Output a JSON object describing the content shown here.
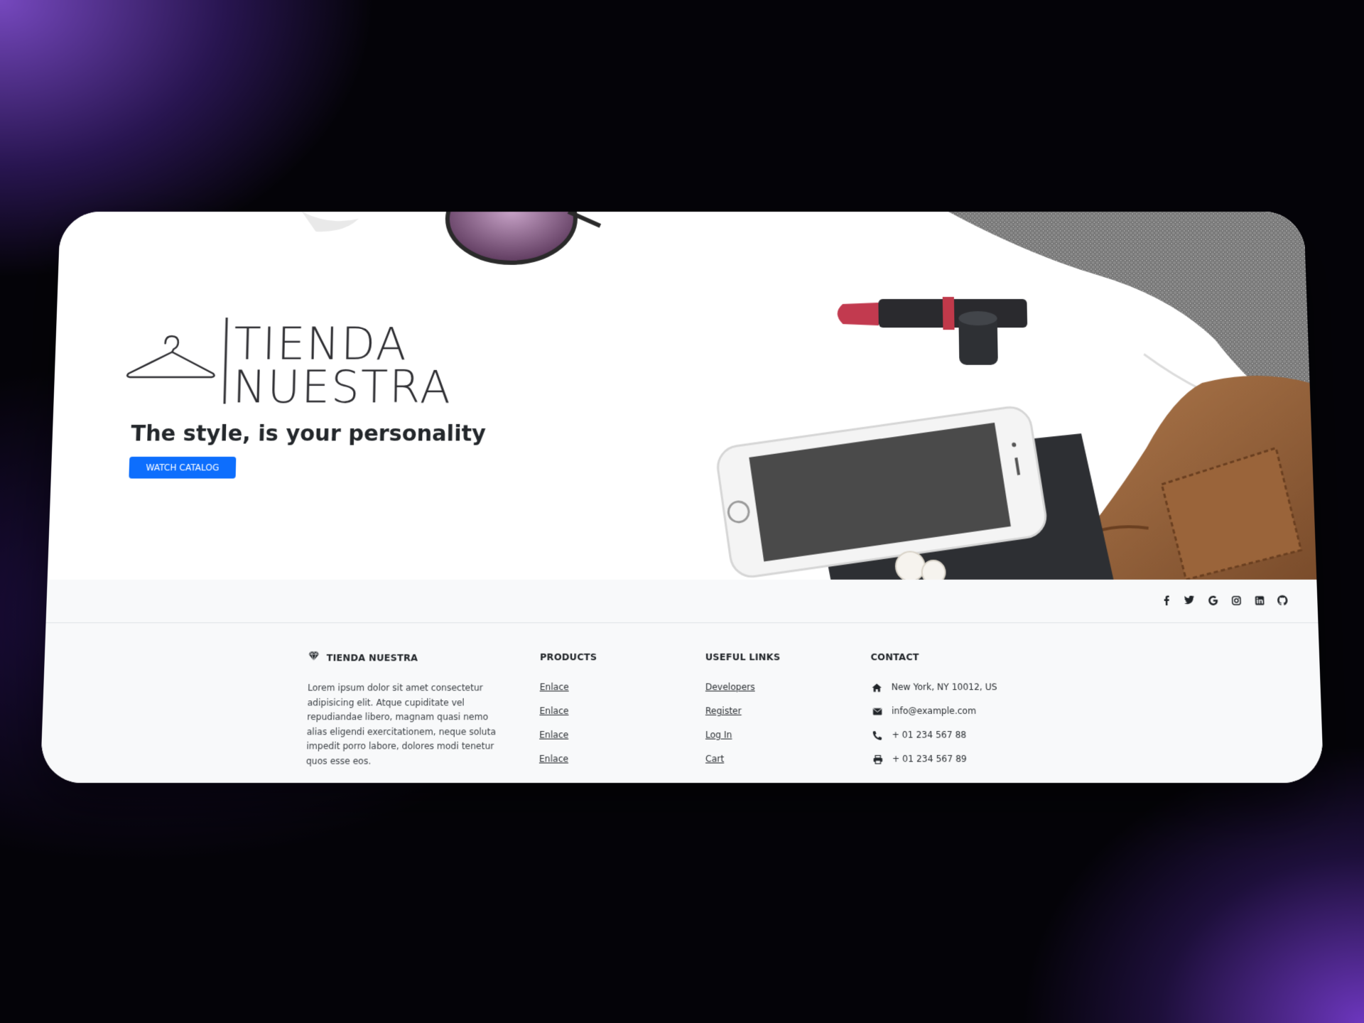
{
  "brand": {
    "logo_line1": "TIENDA",
    "logo_line2": "NUESTRA",
    "footer_name": "TIENDA NUESTRA"
  },
  "hero": {
    "tagline": "The style, is your personality",
    "cta_label": "WATCH CATALOG"
  },
  "social": {
    "icons": [
      "facebook-icon",
      "twitter-icon",
      "google-icon",
      "instagram-icon",
      "linkedin-icon",
      "github-icon"
    ]
  },
  "footer": {
    "about_text": "Lorem ipsum dolor sit amet consectetur adipisicing elit. Atque cupiditate vel repudiandae libero, magnam quasi nemo alias eligendi exercitationem, neque soluta impedit porro labore, dolores modi tenetur quos esse eos.",
    "products": {
      "heading": "PRODUCTS",
      "links": [
        "Enlace",
        "Enlace",
        "Enlace",
        "Enlace"
      ]
    },
    "useful_links": {
      "heading": "USEFUL LINKS",
      "links": [
        "Developers",
        "Register",
        "Log In",
        "Cart"
      ]
    },
    "contact": {
      "heading": "CONTACT",
      "address": "New York, NY 10012, US",
      "email": "info@example.com",
      "phone": "+ 01 234 567 88",
      "fax": "+ 01 234 567 89"
    }
  },
  "colors": {
    "primary_button": "#0d6efd",
    "footer_bg": "#f8f9fa",
    "text_dark": "#212529"
  }
}
